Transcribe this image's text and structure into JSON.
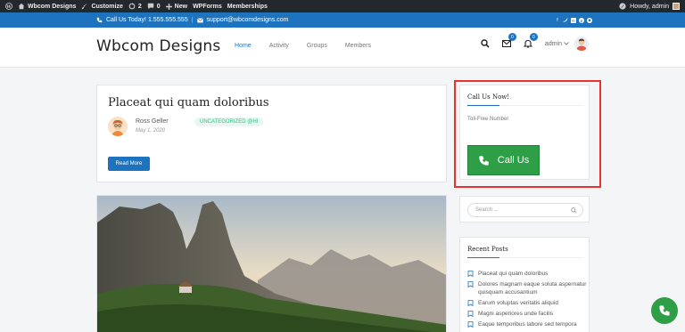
{
  "adminbar": {
    "site_name": "Wbcom Designs",
    "customize": "Customize",
    "updates_count": "2",
    "comments_count": "0",
    "new_label": "New",
    "wpforms": "WPForms",
    "memberships": "Memberships",
    "howdy": "Howdy, admin"
  },
  "topbar": {
    "phone": "Call Us Today! 1.555.555.555",
    "email": "support@wbcomdesigns.com"
  },
  "header": {
    "logo": "Wbcom Designs",
    "nav": [
      "Home",
      "Activity",
      "Groups",
      "Members"
    ],
    "messages_count": "0",
    "notifications_count": "0",
    "username": "admin"
  },
  "post": {
    "title": "Placeat qui quam doloribus",
    "author": "Ross Geller",
    "date": "May 1, 2020",
    "category": "UNCATEGORIZED @HI",
    "read_more": "Read More"
  },
  "callwidget": {
    "title": "Call Us Now!",
    "toll_free": "Toll-Free Number",
    "button": "Call Us"
  },
  "search": {
    "placeholder": "Search ..."
  },
  "recent": {
    "title": "Recent Posts",
    "items": [
      "Placeat qui quam doloribus",
      "Dolores magnam eaque soluta aspernatur quisquam accusantium",
      "Earum voluptas veritatis aliquid",
      "Magni asperiores unde facilis",
      "Eaque temporibus labore sed tempora"
    ]
  },
  "colors": {
    "adminbar": "#23282d",
    "primary": "#1e73be",
    "call_green": "#2e9e47",
    "highlight": "#e8342f"
  }
}
